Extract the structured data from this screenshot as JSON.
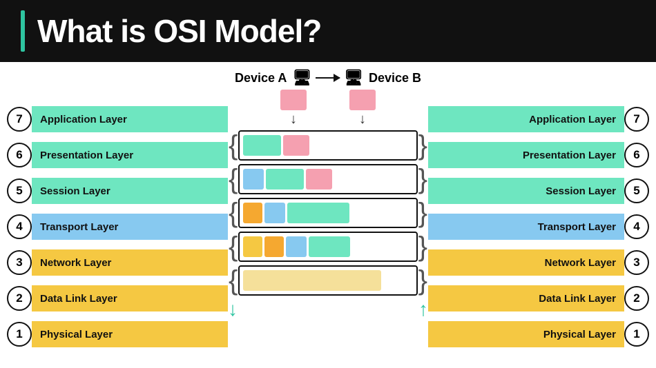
{
  "header": {
    "title": "What is OSI Model?",
    "accent_color": "#2ec4a0"
  },
  "devices": {
    "device_a": "Device A",
    "device_b": "Device B",
    "arrow_direction": "left-to-right"
  },
  "layers_left": [
    {
      "num": 7,
      "label": "Application Layer",
      "color": "app"
    },
    {
      "num": 6,
      "label": "Presentation Layer",
      "color": "pres"
    },
    {
      "num": 5,
      "label": "Session Layer",
      "color": "sess"
    },
    {
      "num": 4,
      "label": "Transport Layer",
      "color": "trans"
    },
    {
      "num": 3,
      "label": "Network Layer",
      "color": "net"
    },
    {
      "num": 2,
      "label": "Data Link  Layer",
      "color": "data"
    },
    {
      "num": 1,
      "label": "Physical Layer",
      "color": "phys"
    }
  ],
  "layers_right": [
    {
      "num": 7,
      "label": "Application Layer",
      "color": "app"
    },
    {
      "num": 6,
      "label": "Presentation Layer",
      "color": "pres"
    },
    {
      "num": 5,
      "label": "Session Layer",
      "color": "sess"
    },
    {
      "num": 4,
      "label": "Transport Layer",
      "color": "trans"
    },
    {
      "num": 3,
      "label": "Network Layer",
      "color": "net"
    },
    {
      "num": 2,
      "label": "Data Link  Layer",
      "color": "data"
    },
    {
      "num": 1,
      "label": "Physical Layer",
      "color": "phys"
    }
  ],
  "protocol_rows": [
    {
      "id": "app-row",
      "segments": [
        "r1-s1",
        "r1-s2"
      ]
    },
    {
      "id": "trans-row",
      "segments": [
        "r2-s1",
        "r2-s2",
        "r2-s3"
      ]
    },
    {
      "id": "net-row",
      "segments": [
        "r3-s1",
        "r3-s2",
        "r3-s3"
      ]
    },
    {
      "id": "data-row",
      "segments": [
        "r4-s1",
        "r4-s2",
        "r4-s3",
        "r4-s4"
      ]
    },
    {
      "id": "phys-row",
      "segments": [
        "r5-s1"
      ]
    }
  ]
}
